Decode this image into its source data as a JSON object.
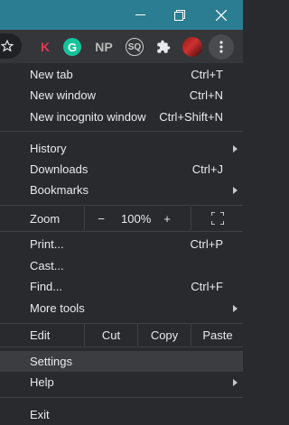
{
  "colors": {
    "titlebar": "#2b7d91",
    "toolbar": "#35363a",
    "menu_bg": "#292a2d",
    "highlight": "#3c3d40",
    "text": "#e8eaed"
  },
  "titlebar": {
    "minimize_icon": "minimize-icon",
    "restore_icon": "restore-icon",
    "close_icon": "close-icon"
  },
  "toolbar": {
    "extensions": [
      {
        "text": "K",
        "color": "#e53955"
      },
      {
        "text": "G",
        "color": "#15c39a"
      },
      {
        "text": "NP",
        "color": "#b8b8b8"
      },
      {
        "text": "SQ",
        "color": "#cfcfcf"
      }
    ]
  },
  "menu": {
    "new_tab": {
      "label": "New tab",
      "shortcut": "Ctrl+T"
    },
    "new_window": {
      "label": "New window",
      "shortcut": "Ctrl+N"
    },
    "new_incognito": {
      "label": "New incognito window",
      "shortcut": "Ctrl+Shift+N"
    },
    "history": {
      "label": "History"
    },
    "downloads": {
      "label": "Downloads",
      "shortcut": "Ctrl+J"
    },
    "bookmarks": {
      "label": "Bookmarks"
    },
    "zoom": {
      "label": "Zoom",
      "minus": "−",
      "value": "100%",
      "plus": "+"
    },
    "print": {
      "label": "Print...",
      "shortcut": "Ctrl+P"
    },
    "cast": {
      "label": "Cast..."
    },
    "find": {
      "label": "Find...",
      "shortcut": "Ctrl+F"
    },
    "more_tools": {
      "label": "More tools"
    },
    "edit": {
      "label": "Edit",
      "cut": "Cut",
      "copy": "Copy",
      "paste": "Paste"
    },
    "settings": {
      "label": "Settings"
    },
    "help": {
      "label": "Help"
    },
    "exit": {
      "label": "Exit"
    }
  }
}
